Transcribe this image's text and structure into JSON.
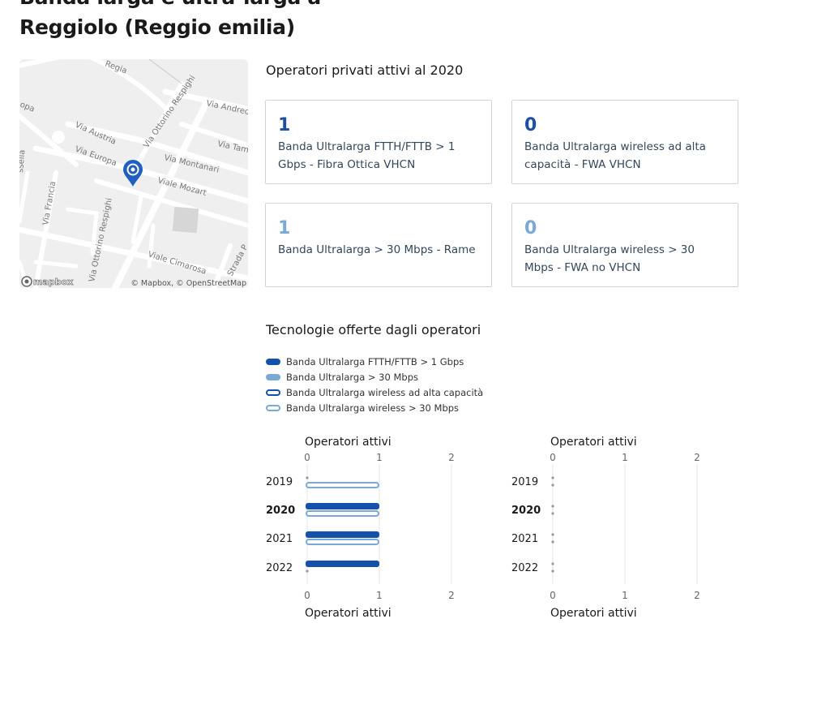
{
  "page": {
    "title_line1": "Banda larga e ultra-larga a",
    "title_line2": "Reggiolo (Reggio emilia)"
  },
  "map": {
    "streets": [
      "Regia",
      "Via Ottorino Respighi",
      "Via Andreoli",
      "Via Austria",
      "Via Tam",
      "Via Europa",
      "Via Montanari",
      "Viale Mozart",
      "Via Francia",
      "Via Ottorino Respighi",
      "Viale Cimarosa",
      "Strada P",
      "ssella",
      "opa"
    ],
    "logo": "mapbox",
    "attribution": "© Mapbox, © OpenStreetMap",
    "marker_icon": "map-marker-icon"
  },
  "operators": {
    "section_title": "Operatori privati attivi al 2020",
    "cards": [
      {
        "value": "1",
        "label": "Banda Ultralarga FTTH/FTTB > 1 Gbps - Fibra Ottica VHCN",
        "color": "#1f4ea3"
      },
      {
        "value": "0",
        "label": "Banda Ultralarga wireless ad alta capacità - FWA VHCN",
        "color": "#1f4ea3"
      },
      {
        "value": "1",
        "label": "Banda Ultralarga > 30 Mbps - Rame",
        "color": "#7ba9d6"
      },
      {
        "value": "0",
        "label": "Banda Ultralarga wireless > 30 Mbps - FWA no VHCN",
        "color": "#7ba9d6"
      }
    ]
  },
  "technologies": {
    "section_title": "Tecnologie offerte dagli operatori",
    "legend": [
      {
        "label": "Banda Ultralarga FTTH/FTTB > 1 Gbps",
        "style": "filled",
        "color": "#1352a8"
      },
      {
        "label": "Banda Ultralarga > 30 Mbps",
        "style": "filled",
        "color": "#7ba9d6"
      },
      {
        "label": "Banda Ultralarga wireless ad alta capacità",
        "style": "outline",
        "color": "#1352a8"
      },
      {
        "label": "Banda Ultralarga wireless > 30 Mbps",
        "style": "outline",
        "color": "#7ba9d6"
      }
    ]
  },
  "chart_data": [
    {
      "type": "bar",
      "orientation": "horizontal",
      "title": "",
      "xlabel": "Operatori attivi",
      "ylabel": "",
      "xlim": [
        0,
        2
      ],
      "xticks": [
        "0",
        "1",
        "2"
      ],
      "categories": [
        "2019",
        "2020",
        "2021",
        "2022"
      ],
      "highlight_category": "2020",
      "grid": true,
      "series": [
        {
          "name": "Banda Ultralarga FTTH/FTTB > 1 Gbps",
          "style": "filled",
          "color": "#1352a8",
          "values": [
            0,
            1,
            1,
            1
          ]
        },
        {
          "name": "Banda Ultralarga wireless > 30 Mbps",
          "style": "outline",
          "color": "#7ba9d6",
          "values": [
            1,
            1,
            1,
            0
          ]
        }
      ]
    },
    {
      "type": "bar",
      "orientation": "horizontal",
      "title": "",
      "xlabel": "Operatori attivi",
      "ylabel": "",
      "xlim": [
        0,
        2
      ],
      "xticks": [
        "0",
        "1",
        "2"
      ],
      "categories": [
        "2019",
        "2020",
        "2021",
        "2022"
      ],
      "highlight_category": "2020",
      "grid": true,
      "series": [
        {
          "name": "Banda Ultralarga > 30 Mbps",
          "style": "filled",
          "color": "#7ba9d6",
          "values": [
            0,
            0,
            0,
            0
          ]
        },
        {
          "name": "Banda Ultralarga wireless ad alta capacità",
          "style": "outline",
          "color": "#1352a8",
          "values": [
            0,
            0,
            0,
            0
          ]
        }
      ]
    }
  ]
}
